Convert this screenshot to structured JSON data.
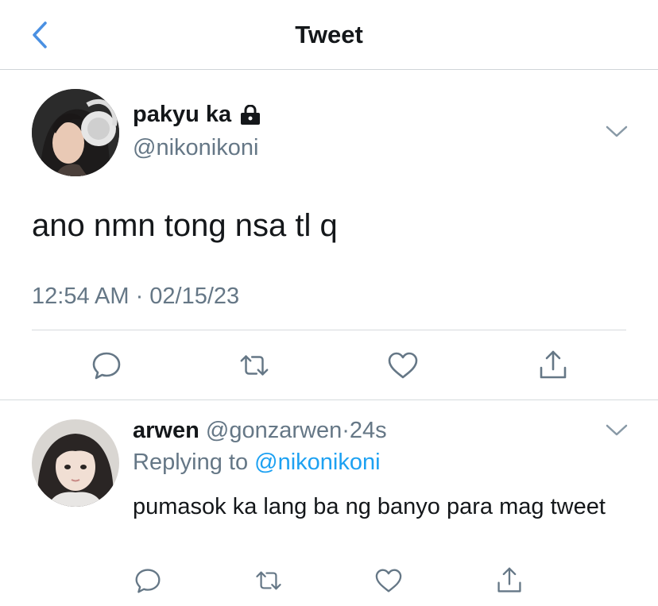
{
  "header": {
    "title": "Tweet",
    "back_icon": "chevron-left-icon"
  },
  "colors": {
    "accent": "#1da1f2",
    "back_icon": "#4a90e2",
    "text": "#14171a",
    "muted": "#657786",
    "divider": "#d6dadd"
  },
  "main_tweet": {
    "display_name": "pakyu ka",
    "protected_icon": "lock-icon",
    "handle": "@nikonikoni",
    "text": "ano nmn tong nsa tl q",
    "timestamp": "12:54 AM · 02/15/23",
    "menu_icon": "chevron-down-icon",
    "actions": [
      "reply-icon",
      "retweet-icon",
      "like-icon",
      "share-icon"
    ]
  },
  "reply": {
    "display_name": "arwen",
    "handle": "@gonzarwen",
    "separator": "·",
    "time": "24s",
    "replying_label": "Replying to",
    "replying_handle": "@nikonikoni",
    "text": "pumasok ka lang ba ng banyo para mag tweet",
    "menu_icon": "chevron-down-icon",
    "actions": [
      "reply-icon",
      "retweet-icon",
      "like-icon",
      "share-icon"
    ]
  }
}
